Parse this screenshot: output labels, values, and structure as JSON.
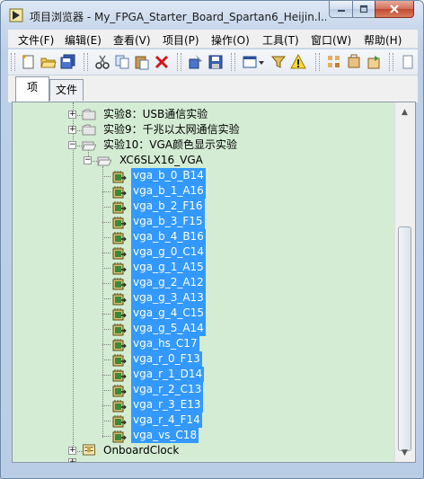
{
  "window": {
    "title": "项目浏览器 - My_FPGA_Starter_Board_Spartan6_Heijin.l..."
  },
  "menubar": {
    "items": [
      "文件(F)",
      "编辑(E)",
      "查看(V)",
      "项目(P)",
      "操作(O)",
      "工具(T)",
      "窗口(W)",
      "帮助(H)"
    ]
  },
  "toolbar": {
    "icons": [
      "new-icon",
      "open-icon",
      "save-all-icon",
      "cut-icon",
      "copy-icon",
      "paste-icon",
      "delete-icon",
      "build-icon",
      "save-icon",
      "view-icon",
      "dropdown-arrow-icon",
      "filter-icon",
      "warning-icon",
      "tools-icon",
      "arrange-icon",
      "refresh-icon",
      "page-icon"
    ]
  },
  "tabs": [
    "项",
    "文件"
  ],
  "tree": {
    "parents": [
      {
        "label": "实验8：USB通信实验",
        "expanded": false
      },
      {
        "label": "实验9：千兆以太网通信实验",
        "expanded": false
      },
      {
        "label": "实验10：VGA颜色显示实验",
        "expanded": true
      }
    ],
    "target": {
      "label": "XC6SLX16_VGA",
      "expanded": true
    },
    "pins": [
      "vga_b_0_B14",
      "vga_b_1_A16",
      "vga_b_2_F16",
      "vga_b_3_F15",
      "vga_b_4_B16",
      "vga_g_0_C14",
      "vga_g_1_A15",
      "vga_g_2_A12",
      "vga_g_3_A13",
      "vga_g_4_C15",
      "vga_g_5_A14",
      "vga_hs_C17",
      "vga_r_0_F13",
      "vga_r_1_D14",
      "vga_r_2_C13",
      "vga_r_3_E13",
      "vga_r_4_F14",
      "vga_vs_C18"
    ],
    "after": [
      {
        "label": "OnboardClock",
        "expanded": false
      }
    ]
  },
  "colors": {
    "tree_background": "#d4ecd4",
    "selection": "#3399ff"
  }
}
